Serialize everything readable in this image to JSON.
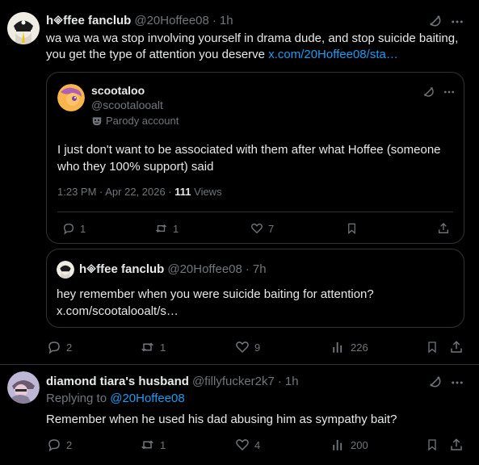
{
  "post1": {
    "author_name": "h🞜ffee fanclub",
    "author_handle": "@20Hoffee08",
    "time": "1h",
    "text": "wa wa wa wa stop involving yourself in drama dude, and stop suicide baiting, you get the type of attention you deserve ",
    "link": "x.com/20Hoffee08/sta…",
    "quote": {
      "author_name": "scootaloo",
      "author_handle": "@scootalooalt",
      "parody_label": "Parody account",
      "text": "I just don't want to be associated with them after what Hoffee (someone who they 100% support) said",
      "timestamp": "1:23 PM · Apr 22, 2026 · ",
      "views_count": "111",
      "views_label": " Views",
      "replies": "1",
      "reposts": "1",
      "likes": "7"
    },
    "nested_quote": {
      "author_name": "h🞜ffee fanclub",
      "author_handle": "@20Hoffee08",
      "time": "7h",
      "text": "hey remember when you were suicide baiting for attention? x.com/scootalooalt/s…"
    },
    "replies": "2",
    "reposts": "1",
    "likes": "9",
    "views": "226"
  },
  "post2": {
    "author_name": "diamond tiara's husband",
    "author_handle": "@fillyfucker2k7",
    "time": "1h",
    "replying_to_label": "Replying to ",
    "replying_to_handle": "@20Hoffee08",
    "text": "Remember when he used his dad abusing him as sympathy bait?",
    "replies": "2",
    "reposts": "1",
    "likes": "4",
    "views": "200"
  },
  "separator": "·",
  "icons": {
    "grok": "grok-icon",
    "more": "more-icon",
    "reply": "reply-icon",
    "repost": "repost-icon",
    "like": "heart-icon",
    "views": "views-icon",
    "bookmark": "bookmark-icon",
    "share": "share-icon",
    "parody": "mask-icon"
  },
  "colors": {
    "link": "#1d9bf0",
    "muted": "#71767b",
    "text": "#e7e9ea",
    "border": "#2f3336"
  }
}
